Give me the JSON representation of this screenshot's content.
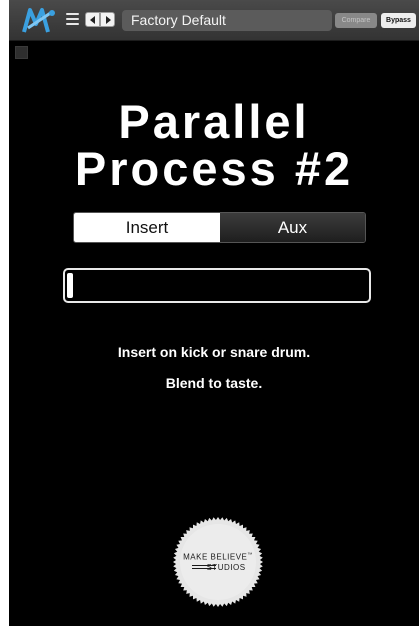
{
  "toolbar": {
    "preset_name": "Factory Default",
    "compare_label": "Compare",
    "bypass_label": "Bypass"
  },
  "plugin": {
    "title_line1": "Parallel",
    "title_line2": "Process #2"
  },
  "mode": {
    "options": [
      "Insert",
      "Aux"
    ],
    "selected": "Insert"
  },
  "blend": {
    "value": 0.02
  },
  "instructions": {
    "line1": "Insert on kick or snare drum.",
    "line2": "Blend to taste."
  },
  "brand": {
    "line1": "MAKE BELIEVE",
    "line2": "STUDIOS",
    "trademark": "™"
  },
  "colors": {
    "background": "#000000",
    "toolbar": "#3d3d3d",
    "accent_logo": "#3aa0e0",
    "text": "#ffffff"
  },
  "icons": [
    "plugin-logo-icon",
    "menu-icon",
    "prev-preset-icon",
    "next-preset-icon",
    "small-square-icon"
  ]
}
